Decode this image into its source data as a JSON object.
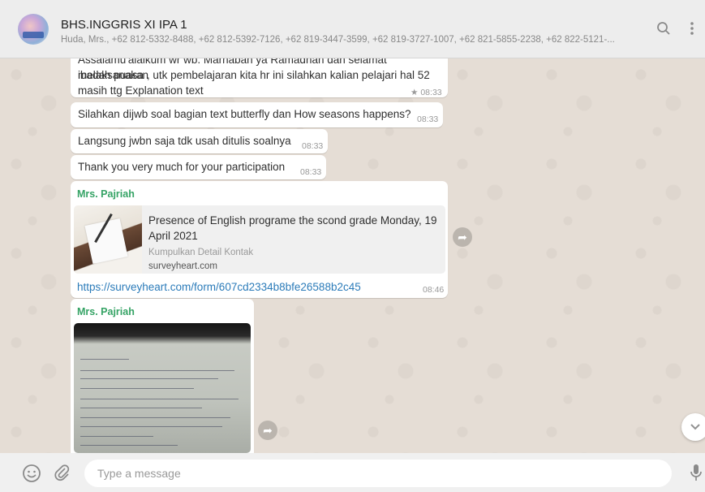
{
  "header": {
    "title": "BHS.INGGRIS XI IPA 1",
    "members": "Huda, Mrs., +62 812-5332-8488, +62 812-5392-7126, +62 819-3447-3599, +62 819-3727-1007, +62 821-5855-2238, +62 822-5121-...",
    "icons": [
      "search-icon",
      "menu-icon"
    ]
  },
  "messages": [
    {
      "text_lines": [
        "Assalamu'alaikum wr wb. Marhaban ya Ramadhan dan selamat melaksanakan",
        "ibadah puasa , utk pembelajaran kita hr ini silahkan kalian pelajari hal 52",
        "masih ttg  Explanation text"
      ],
      "time": "08:33",
      "starred": true
    },
    {
      "text": "Silahkan dijwb soal bagian text butterfly dan How seasons happens?",
      "time": "08:33"
    },
    {
      "text": "Langsung jwbn saja tdk usah ditulis soalnya",
      "time": "08:33"
    },
    {
      "text": "Thank you very much for your participation",
      "time": "08:33"
    },
    {
      "sender": "Mrs. Pajriah",
      "preview": {
        "title": "Presence of English programe the scond grade Monday, 19 April 2021",
        "description": "Kumpulkan Detail Kontak",
        "domain": "surveyheart.com"
      },
      "link": "https://surveyheart.com/form/607cd2334b8bfe26588b2c45",
      "time": "08:46"
    },
    {
      "sender": "Mrs. Pajriah",
      "media": "handwritten-notes-photo"
    }
  ],
  "footer": {
    "placeholder": "Type a message",
    "icons": [
      "emoji-icon",
      "attach-icon",
      "mic-icon"
    ]
  },
  "colors": {
    "sender": "#35a365",
    "link": "#2b7bb9",
    "chat_background": "#e5ddd5",
    "header_background": "#ededed"
  }
}
